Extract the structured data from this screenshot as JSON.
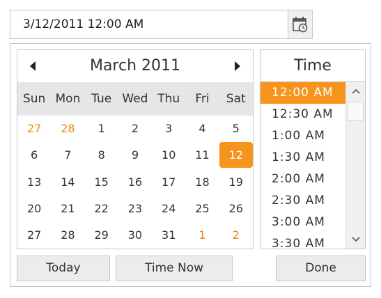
{
  "input": {
    "value": "3/12/2011 12:00 AM"
  },
  "calendar": {
    "title": "March 2011",
    "weekdays": [
      "Sun",
      "Mon",
      "Tue",
      "Wed",
      "Thu",
      "Fri",
      "Sat"
    ],
    "weeks": [
      [
        {
          "d": "27",
          "other": true
        },
        {
          "d": "28",
          "other": true
        },
        {
          "d": "1"
        },
        {
          "d": "2"
        },
        {
          "d": "3"
        },
        {
          "d": "4"
        },
        {
          "d": "5"
        }
      ],
      [
        {
          "d": "6"
        },
        {
          "d": "7"
        },
        {
          "d": "8"
        },
        {
          "d": "9"
        },
        {
          "d": "10"
        },
        {
          "d": "11"
        },
        {
          "d": "12",
          "selected": true
        }
      ],
      [
        {
          "d": "13"
        },
        {
          "d": "14"
        },
        {
          "d": "15"
        },
        {
          "d": "16"
        },
        {
          "d": "17"
        },
        {
          "d": "18"
        },
        {
          "d": "19"
        }
      ],
      [
        {
          "d": "20"
        },
        {
          "d": "21"
        },
        {
          "d": "22"
        },
        {
          "d": "23"
        },
        {
          "d": "24"
        },
        {
          "d": "25"
        },
        {
          "d": "26"
        }
      ],
      [
        {
          "d": "27"
        },
        {
          "d": "28"
        },
        {
          "d": "29"
        },
        {
          "d": "30"
        },
        {
          "d": "31"
        },
        {
          "d": "1",
          "other": true
        },
        {
          "d": "2",
          "other": true
        }
      ]
    ]
  },
  "time": {
    "header": "Time",
    "items": [
      "12:00 AM",
      "12:30 AM",
      "1:00 AM",
      "1:30 AM",
      "2:00 AM",
      "2:30 AM",
      "3:00 AM",
      "3:30 AM"
    ],
    "selected_index": 0
  },
  "buttons": {
    "today": "Today",
    "time_now": "Time Now",
    "done": "Done"
  },
  "colors": {
    "accent": "#f7941d",
    "other_month": "#e8890c",
    "header_bg": "#e6e6e6"
  },
  "icons": {
    "calendar": "calendar-clock-icon",
    "prev": "triangle-left-icon",
    "next": "triangle-right-icon",
    "up": "chevron-up-icon",
    "down": "chevron-down-icon"
  }
}
